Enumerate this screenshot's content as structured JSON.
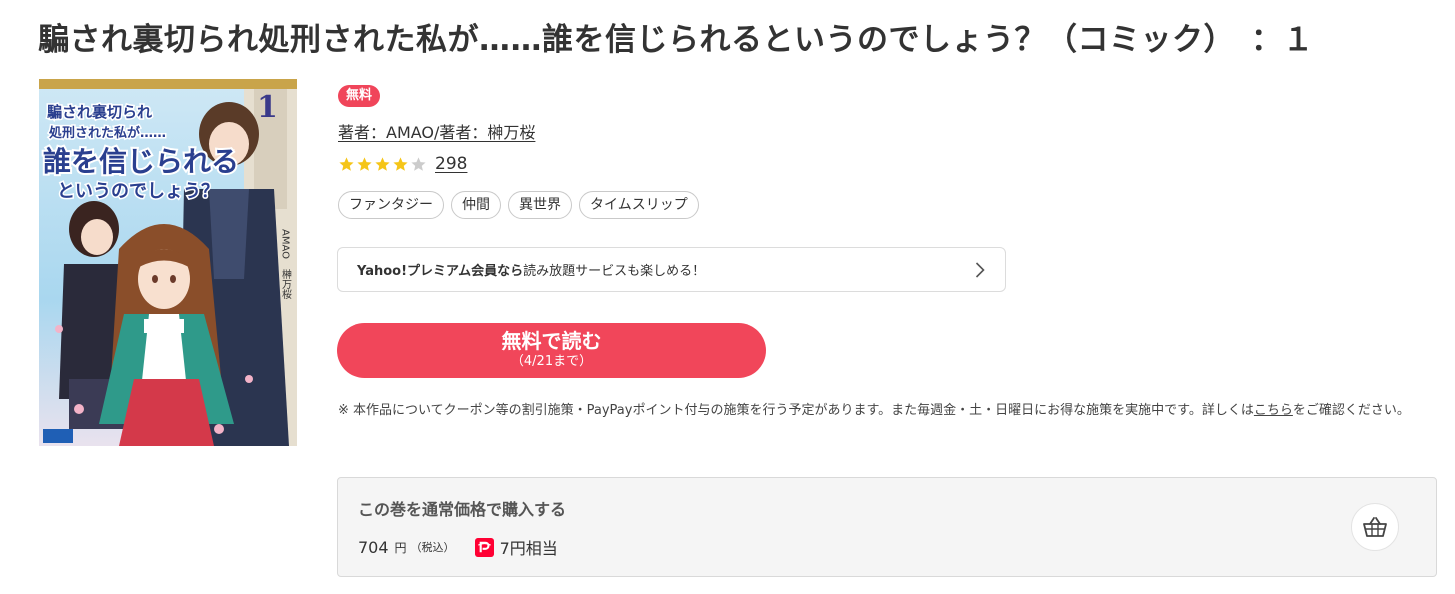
{
  "page": {
    "title": "騙され裏切られ処刑された私が……誰を信じられるというのでしょう？（コミック）　：１"
  },
  "cover": {
    "cover_text": "騙され裏切られ処刑された私が……誰を信じられるというのでしょう？",
    "volume_number": "1",
    "author_vertical": "AMAO 榊万桜",
    "colors": {
      "sky": "#a9d7ef",
      "hair": "#8a4e2a",
      "cloak": "#2f9a8a",
      "skirt": "#d4394a"
    }
  },
  "badge": {
    "label": "無料",
    "color": "#f0455a"
  },
  "author": {
    "text": "著者：AMAO/著者：榊万桜"
  },
  "rating": {
    "value": 4,
    "max": 5,
    "count": "298",
    "star_color": "#f5c518",
    "empty_color": "#cccccc"
  },
  "tags": [
    "ファンタジー",
    "仲間",
    "異世界",
    "タイムスリップ"
  ],
  "premium": {
    "bold": "Yahoo!プレミアム会員なら",
    "rest": "読み放題サービスも楽しめる！",
    "icon": "chevron-right-icon"
  },
  "read_button": {
    "label": "無料で読む",
    "sub": "（4/21まで）",
    "color": "#f1465a"
  },
  "note": {
    "text": "※ 本作品についてクーポン等の割引施策・PayPayポイント付与の施策を行う予定があります。また毎週金・土・日曜日にお得な施策を実施中です。詳しくは",
    "link": "こちら",
    "tail": "をご確認ください。"
  },
  "purchase": {
    "title": "この巻を通常価格で購入する",
    "price": "704",
    "yen": "円",
    "tax": "（税込）",
    "points": "7円相当",
    "paypay_icon": "paypay-icon",
    "paypay_color": "#ff0033",
    "cart_icon": "shopping-basket-icon"
  }
}
